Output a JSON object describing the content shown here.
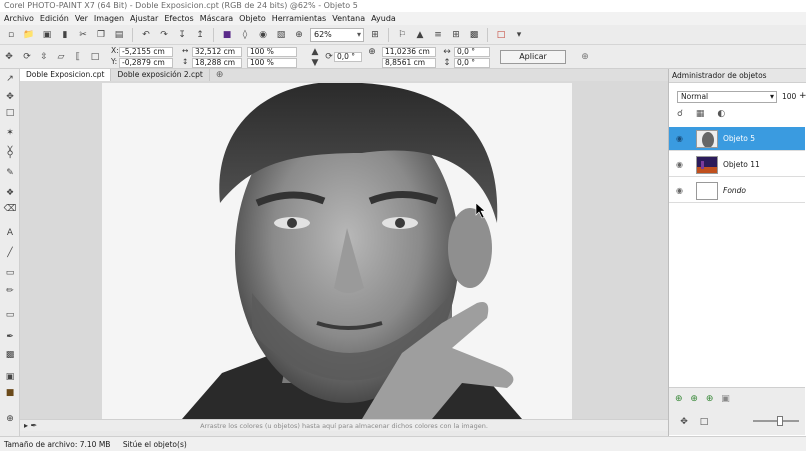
{
  "window": {
    "title": "Corel PHOTO-PAINT X7 (64 Bit) - Doble Exposicion.cpt (RGB de 24 bits) @62% - Objeto 5"
  },
  "menu": [
    "Archivo",
    "Edición",
    "Ver",
    "Imagen",
    "Ajustar",
    "Efectos",
    "Máscara",
    "Objeto",
    "Herramientas",
    "Ventana",
    "Ayuda"
  ],
  "toolbar": {
    "zoom_value": "62%"
  },
  "props": {
    "x_label": "X:",
    "x_value": "-5,2155 cm",
    "y_label": "Y:",
    "y_value": "-0,2879 cm",
    "w_value": "32,512 cm",
    "h_value": "18,288 cm",
    "scale_x": "100 %",
    "scale_y": "100 %",
    "angle": "0,0 °",
    "center_x": "11,0236 cm",
    "center_y": "8,8561 cm",
    "skew_x": "0,0 °",
    "skew_y": "0,0 °",
    "apply_label": "Aplicar"
  },
  "tabs": [
    {
      "label": "Doble Exposicion.cpt",
      "active": true
    },
    {
      "label": "Doble exposición 2.cpt",
      "active": false
    }
  ],
  "hint": "Arrastre los colores (u objetos) hasta aquí para almacenar dichos colores con la imagen.",
  "status": {
    "file_size": "Tamaño de archivo: 7.10 MB",
    "message": "Sitúe el objeto(s)"
  },
  "panel": {
    "title": "Administrador de objetos",
    "blend_mode": "Normal",
    "opacity": "100",
    "layers": [
      {
        "name": "Objeto 5",
        "selected": true,
        "italic": false
      },
      {
        "name": "Objeto 11",
        "selected": false,
        "italic": false
      },
      {
        "name": "Fondo",
        "selected": false,
        "italic": true
      }
    ]
  },
  "colors": {
    "selection": "#3a9be0",
    "chrome": "#ececec",
    "accent_purple": "#5a2a8a"
  }
}
